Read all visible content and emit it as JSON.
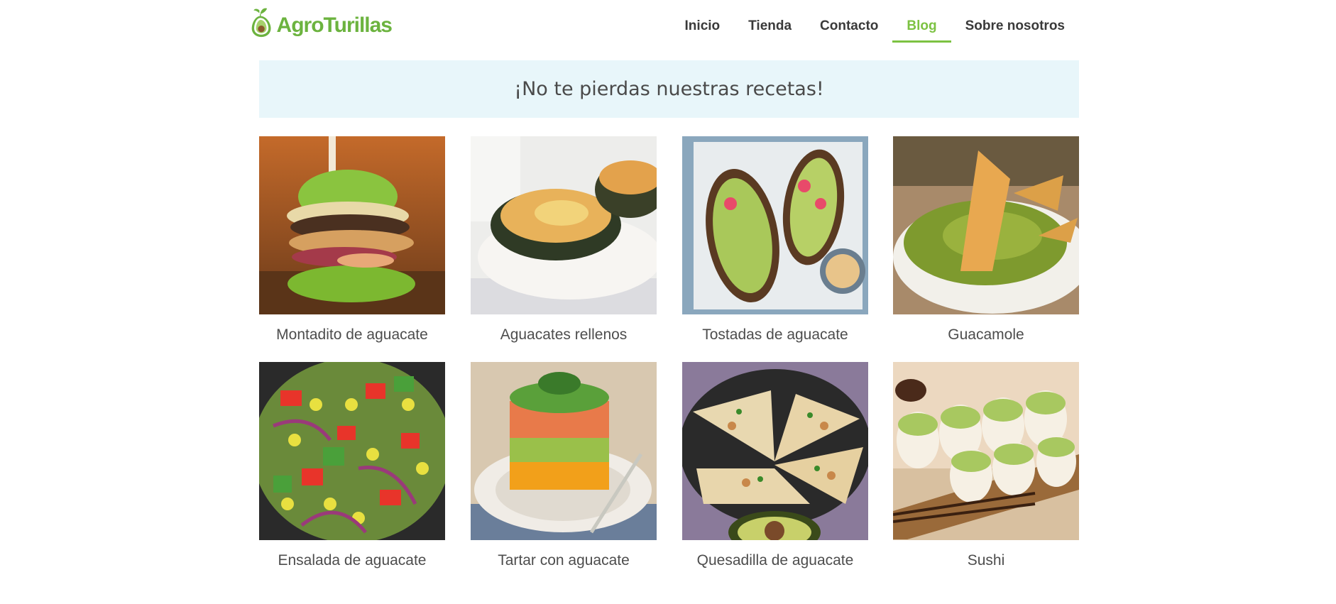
{
  "brand": {
    "name": "AgroTurillas",
    "accent_color": "#7cc242",
    "logo_icon": "avocado-logo-icon"
  },
  "nav": {
    "items": [
      {
        "label": "Inicio",
        "active": false
      },
      {
        "label": "Tienda",
        "active": false
      },
      {
        "label": "Contacto",
        "active": false
      },
      {
        "label": "Blog",
        "active": true
      },
      {
        "label": "Sobre nosotros",
        "active": false
      }
    ]
  },
  "banner": {
    "text": "¡No te pierdas nuestras recetas!",
    "background": "#e8f6fa"
  },
  "recipes": [
    {
      "title": "Montadito de aguacate",
      "image": "avocado-burger-photo"
    },
    {
      "title": "Aguacates rellenos",
      "image": "stuffed-avocado-photo"
    },
    {
      "title": "Tostadas de aguacate",
      "image": "avocado-toast-photo"
    },
    {
      "title": "Guacamole",
      "image": "guacamole-photo"
    },
    {
      "title": "Ensalada de aguacate",
      "image": "avocado-salad-photo"
    },
    {
      "title": "Tartar con aguacate",
      "image": "avocado-tartare-photo"
    },
    {
      "title": "Quesadilla de aguacate",
      "image": "avocado-quesadilla-photo"
    },
    {
      "title": "Sushi",
      "image": "avocado-sushi-photo"
    }
  ]
}
